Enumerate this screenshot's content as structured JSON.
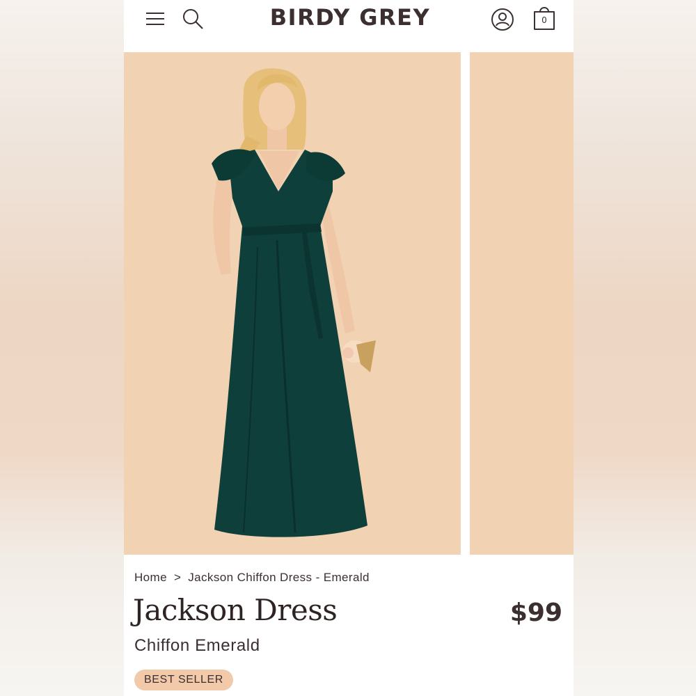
{
  "header": {
    "brand": "BIRDY GREY",
    "menu_icon": "hamburger-menu-icon",
    "search_icon": "search-icon",
    "account_icon": "user-account-icon",
    "bag_icon": "shopping-bag-icon",
    "bag_count": "0"
  },
  "gallery": {
    "background_color": "#f1d2b3",
    "dress_color": "#0e3f3a"
  },
  "breadcrumb": {
    "home": "Home",
    "separator": ">",
    "current": "Jackson Chiffon Dress - Emerald"
  },
  "product": {
    "title": "Jackson Dress",
    "subtitle": "Chiffon Emerald",
    "price": "$99",
    "badge": "BEST SELLER"
  },
  "colors": {
    "text": "#3b2f2f",
    "badge_bg": "#f2c9a9"
  }
}
